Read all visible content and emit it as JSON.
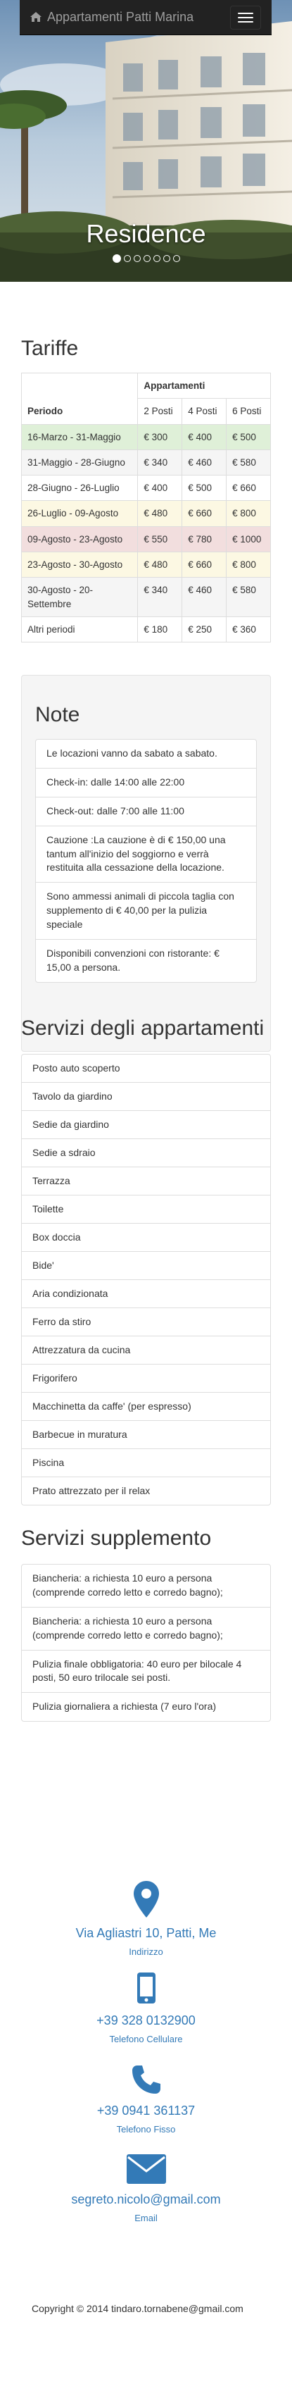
{
  "navbar": {
    "brand": "Appartamenti Patti Marina",
    "home_icon": "home-icon",
    "menu_icon": "hamburger-icon"
  },
  "hero": {
    "caption": "Residence",
    "slides_count": 7,
    "active_slide": 1
  },
  "tariffs": {
    "title": "Tariffe",
    "headers": {
      "period": "Periodo",
      "apartments": "Appartamenti",
      "cols": [
        "2 Posti",
        "4 Posti",
        "6 Posti"
      ]
    },
    "rows": [
      {
        "period": "16-Marzo - 31-Maggio",
        "p2": "€ 300",
        "p4": "€ 400",
        "p6": "€ 500",
        "style": "success"
      },
      {
        "period": "31-Maggio - 28-Giugno",
        "p2": "€ 340",
        "p4": "€ 460",
        "p6": "€ 580",
        "style": "active"
      },
      {
        "period": "28-Giugno - 26-Luglio",
        "p2": "€ 400",
        "p4": "€ 500",
        "p6": "€ 660",
        "style": ""
      },
      {
        "period": "26-Luglio - 09-Agosto",
        "p2": "€ 480",
        "p4": "€ 660",
        "p6": "€ 800",
        "style": "warning"
      },
      {
        "period": "09-Agosto - 23-Agosto",
        "p2": "€ 550",
        "p4": "€ 780",
        "p6": "€ 1000",
        "style": "danger"
      },
      {
        "period": "23-Agosto - 30-Agosto",
        "p2": "€ 480",
        "p4": "€ 660",
        "p6": "€ 800",
        "style": "warning"
      },
      {
        "period": "30-Agosto - 20-Settembre",
        "p2": "€ 340",
        "p4": "€ 460",
        "p6": "€ 580",
        "style": "active"
      },
      {
        "period": "Altri periodi",
        "p2": "€ 180",
        "p4": "€ 250",
        "p6": "€ 360",
        "style": ""
      }
    ]
  },
  "notes": {
    "title": "Note",
    "items": [
      "Le locazioni vanno da sabato a sabato.",
      "Check-in: dalle 14:00 alle 22:00",
      "Check-out: dalle 7:00 alle 11:00",
      "Cauzione :La cauzione è di € 150,00 una tantum all'inizio del soggiorno e verrà restituita alla cessazione della locazione.",
      "Sono ammessi animali di piccola taglia con supplemento di € 40,00 per la pulizia speciale",
      "Disponibili convenzioni con ristorante: € 15,00 a persona."
    ]
  },
  "services": {
    "title": "Servizi degli appartamenti",
    "items": [
      "Posto auto scoperto",
      "Tavolo da giardino",
      "Sedie da giardino",
      "Sedie a sdraio",
      "Terrazza",
      "Toilette",
      "Box doccia",
      "Bide'",
      "Aria condizionata",
      "Ferro da stiro",
      "Attrezzatura da cucina",
      "Frigorifero",
      "Macchinetta da caffe' (per espresso)",
      "Barbecue in muratura",
      "Piscina",
      "Prato attrezzato per il relax"
    ]
  },
  "supplements": {
    "title": "Servizi supplemento",
    "items": [
      "Biancheria: a richiesta 10 euro a persona (comprende corredo letto e corredo bagno);",
      "Biancheria: a richiesta 10 euro a persona (comprende corredo letto e corredo bagno);",
      "Pulizia finale obbligatoria: 40 euro per bilocale 4 posti, 50 euro trilocale sei posti.",
      "Pulizia giornaliera a richiesta (7 euro l'ora)"
    ]
  },
  "contacts": [
    {
      "icon": "map-marker-icon",
      "value": "Via Agliastri 10, Patti, Me",
      "label": "Indirizzo"
    },
    {
      "icon": "mobile-phone-icon",
      "value": "+39 328 0132900",
      "label": "Telefono Cellulare"
    },
    {
      "icon": "phone-icon",
      "value": "+39 0941 361137",
      "label": "Telefono Fisso"
    },
    {
      "icon": "envelope-icon",
      "value": "segreto.nicolo@gmail.com",
      "label": "Email"
    }
  ],
  "footer": {
    "copyright": "Copyright © 2014 tindaro.tornabene@gmail.com"
  },
  "colors": {
    "link": "#337ab7",
    "navbar": "#222222",
    "success_row": "#dff0d8",
    "warning_row": "#fcf8e3",
    "danger_row": "#f2dede",
    "active_row": "#f5f5f5"
  }
}
